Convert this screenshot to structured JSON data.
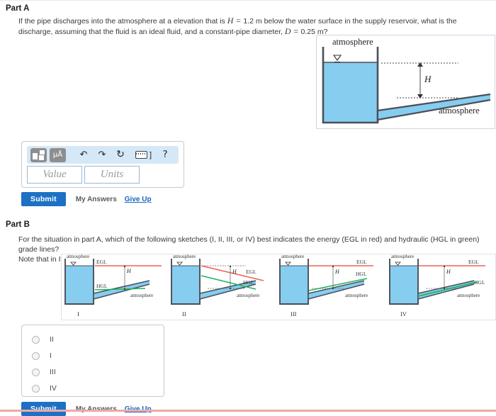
{
  "partA": {
    "title": "Part A",
    "question_pre": "If the pipe discharges into the atmosphere at a elevation that is",
    "H_sym": "H",
    "H_eq": "=",
    "H_val": "1.2 m",
    "question_mid": "below the water surface in the supply reservoir, what is the discharge, assuming that the fluid is an ideal fluid, and a constant-pipe diameter,",
    "D_sym": "D",
    "D_eq": "=",
    "D_val": "0.25 m?",
    "toolbar": {
      "template_button": "template-matrix",
      "units_button": "µÅ",
      "undo": "↶",
      "redo": "↷",
      "reset": "↻",
      "keyboard_bracket": "]",
      "help": "?"
    },
    "value_placeholder": "Value",
    "units_placeholder": "Units",
    "submit_label": "Submit",
    "my_answers_label": "My Answers",
    "give_up_label": "Give Up",
    "figure": {
      "top_label": "atmosphere",
      "right_label": "atmosphere",
      "height_label": "H"
    }
  },
  "partB": {
    "title": "Part B",
    "question_line1": "For the situation in part A, which of the following sketches (I, II, III, or IV) best indicates the energy (EGL in red) and hydraulic (HGL in green)  grade lines?",
    "question_line2": "Note that in IV, the HGL runs along the pipe centerline.",
    "sketches": [
      {
        "caption": "I",
        "atmosphere_top": "atmosphere",
        "atmosphere_pipe": "atmosphere",
        "egl_label": "EGL",
        "hgl_label": "HGL",
        "h_label": "H",
        "egl_style": "horizontal",
        "hgl_style": "horizontal"
      },
      {
        "caption": "II",
        "atmosphere_top": "atmosphere",
        "atmosphere_pipe": "atmosphere",
        "egl_label": "EGL",
        "hgl_label": "HGL",
        "h_label": "H",
        "egl_style": "sloping-down",
        "hgl_style": "sloping-down"
      },
      {
        "caption": "III",
        "atmosphere_top": "atmosphere",
        "atmosphere_pipe": "atmosphere",
        "egl_label": "EGL",
        "hgl_label": "HGL",
        "h_label": "H",
        "egl_style": "horizontal",
        "hgl_style": "sloping-up"
      },
      {
        "caption": "IV",
        "atmosphere_top": "atmosphere",
        "atmosphere_pipe": "atmosphere",
        "egl_label": "EGL",
        "hgl_label": "HGL",
        "h_label": "H",
        "egl_style": "horizontal",
        "hgl_style": "pipe-centerline"
      }
    ],
    "choices": [
      {
        "label": "II",
        "selected": false
      },
      {
        "label": "I",
        "selected": false
      },
      {
        "label": "III",
        "selected": false
      },
      {
        "label": "IV",
        "selected": false
      }
    ],
    "submit_label": "Submit",
    "my_answers_label": "My Answers",
    "give_up_label": "Give Up"
  },
  "colors": {
    "water": "#86cdf0",
    "egl_red": "#f0615c",
    "hgl_green": "#23b35c",
    "wall": "#4a4f57",
    "submit_blue": "#1c71c4",
    "link_blue": "#1565c0",
    "toolbar_blue": "#d5e8f7"
  }
}
